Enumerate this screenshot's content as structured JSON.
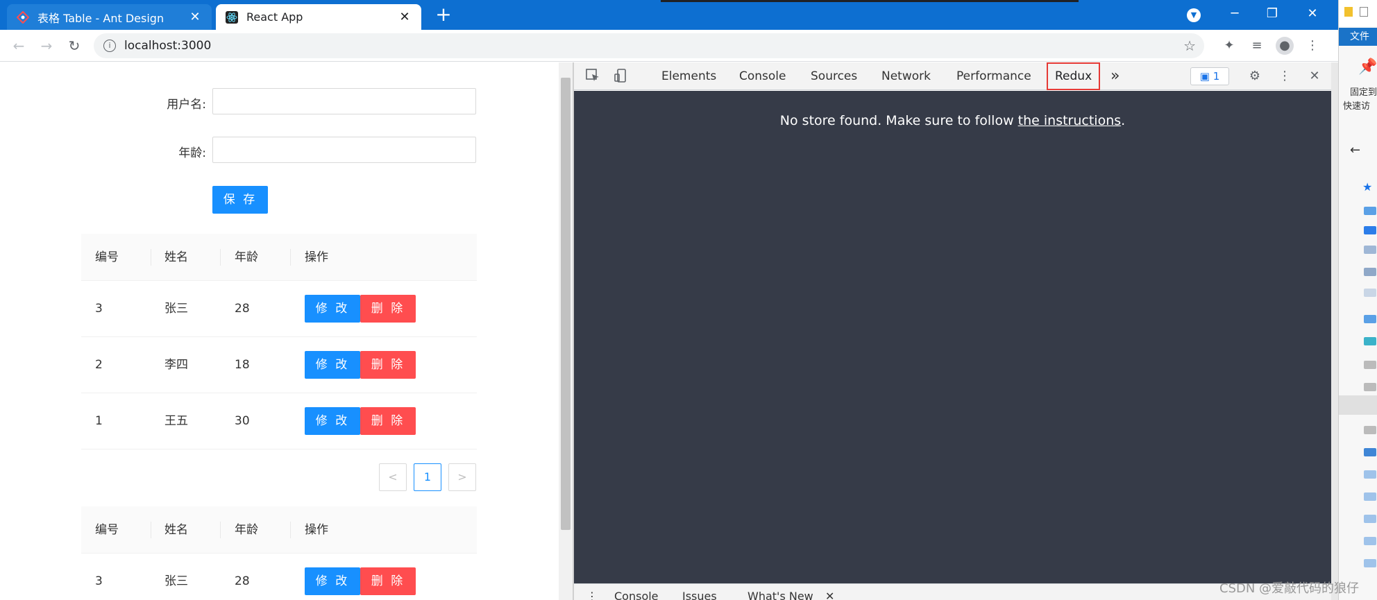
{
  "browser": {
    "tabs": [
      {
        "title": "表格 Table - Ant Design",
        "active": false
      },
      {
        "title": "React App",
        "active": true
      }
    ],
    "address": "localhost:3000"
  },
  "form": {
    "username_label": "用户名:",
    "age_label": "年龄:",
    "save_label": "保 存"
  },
  "table": {
    "headers": [
      "编号",
      "姓名",
      "年龄",
      "操作"
    ],
    "rows": [
      {
        "id": "3",
        "name": "张三",
        "age": "28"
      },
      {
        "id": "2",
        "name": "李四",
        "age": "18"
      },
      {
        "id": "1",
        "name": "王五",
        "age": "30"
      }
    ],
    "edit_label": "修 改",
    "delete_label": "删 除"
  },
  "pagination": {
    "prev": "<",
    "current": "1",
    "next": ">"
  },
  "table2": {
    "rows": [
      {
        "id": "3",
        "name": "张三",
        "age": "28"
      }
    ]
  },
  "devtools": {
    "tabs": [
      "Elements",
      "Console",
      "Sources",
      "Network",
      "Performance",
      "Redux"
    ],
    "selected_tab": "Redux",
    "more": "»",
    "messages_count": "1",
    "notice_prefix": "No store found. Make sure to follow ",
    "notice_link": "the instructions",
    "notice_suffix": ".",
    "drawer_tabs": [
      "Console",
      "Issues",
      "What's New"
    ]
  },
  "side": {
    "file_label": "文件",
    "pin_text_1": "固定到",
    "pin_text_2": "快速访"
  },
  "watermark": "CSDN @爱敲代码的狼仔",
  "colors": {
    "primary": "#1890ff",
    "danger": "#ff4d4f",
    "devtools_bg": "#363b48",
    "chrome_blue": "#0d6fd1",
    "highlight_red": "#e53935"
  }
}
